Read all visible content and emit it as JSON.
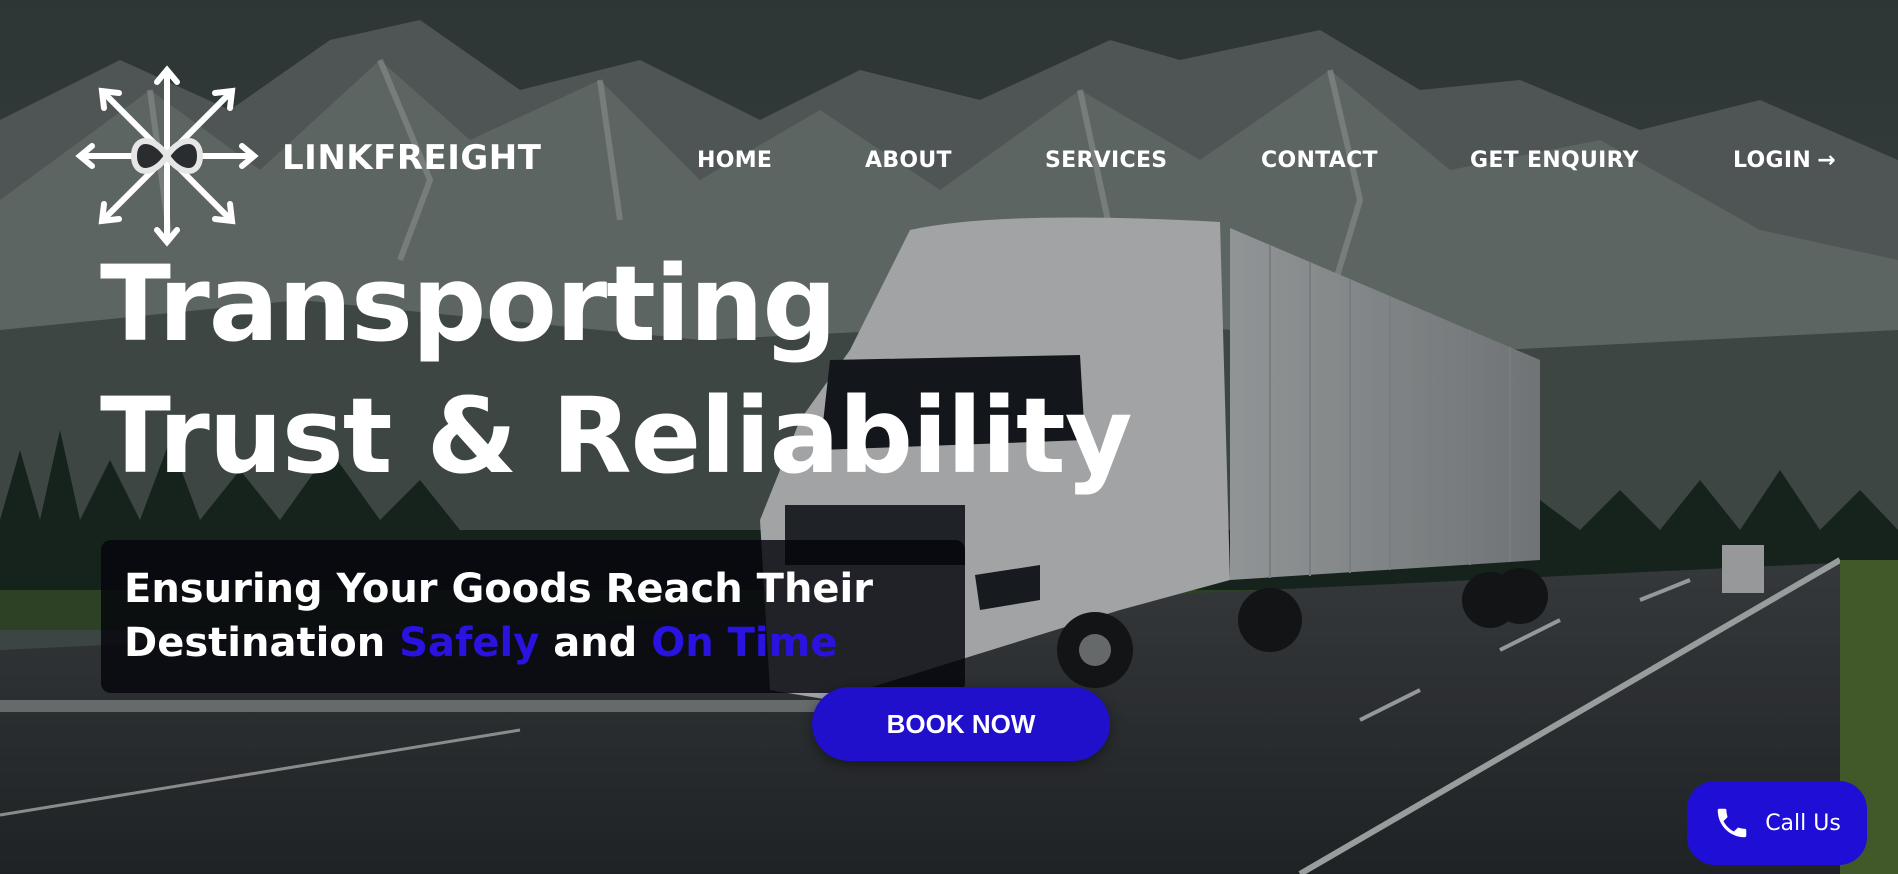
{
  "brand": {
    "name": "LINKFREIGHT",
    "logo_icon": "arrows-infinity-logo-icon"
  },
  "nav": {
    "items": [
      {
        "label": "HOME"
      },
      {
        "label": "ABOUT"
      },
      {
        "label": "SERVICES"
      },
      {
        "label": "CONTACT"
      },
      {
        "label": "GET ENQUIRY"
      }
    ],
    "login": {
      "label": "LOGIN",
      "icon": "arrow-right-icon",
      "glyph": "→"
    }
  },
  "hero": {
    "headline_line1": "Transporting",
    "headline_line2": "Trust & Reliability",
    "tagline_part1": "Ensuring Your Goods Reach Their",
    "tagline_part2": "Destination ",
    "tagline_accent1": "Safely",
    "tagline_mid": " and ",
    "tagline_accent2": "On Time",
    "accent_color": "#2a13e0",
    "cta": "BOOK NOW"
  },
  "call": {
    "label": "Call Us",
    "icon": "phone-icon"
  }
}
